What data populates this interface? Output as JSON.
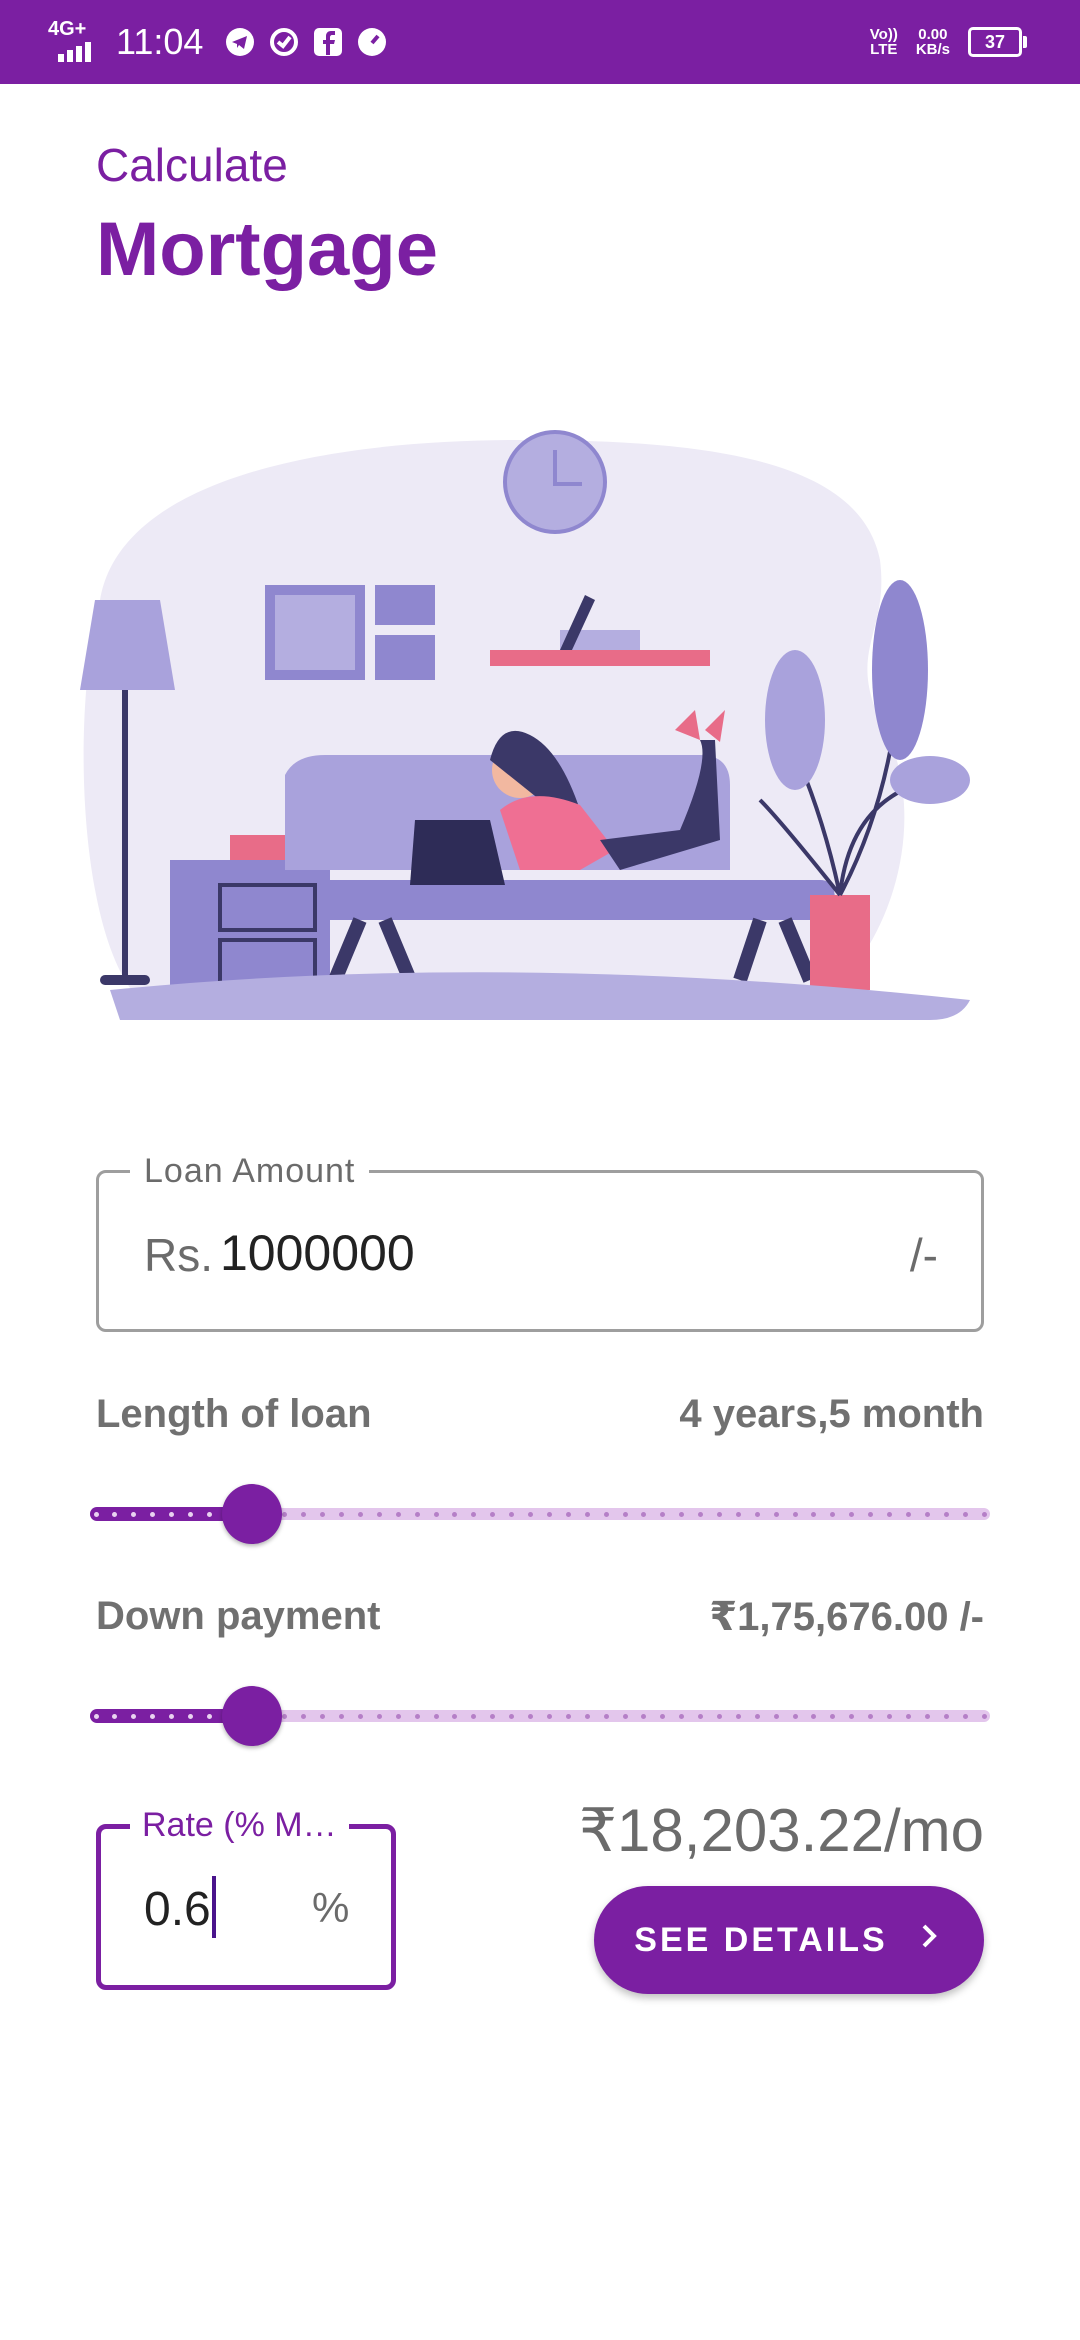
{
  "status_bar": {
    "network": "4G+",
    "time": "11:04",
    "app_icons": [
      "telegram-icon",
      "sync-icon",
      "facebook-icon",
      "speed-icon"
    ],
    "volte_line1": "Vo))",
    "volte_line2": "LTE",
    "speed_line1": "0.00",
    "speed_line2": "KB/s",
    "battery": "37"
  },
  "header": {
    "subtitle": "Calculate",
    "title": "Mortgage"
  },
  "loan_amount": {
    "label": "Loan Amount",
    "prefix": "Rs.",
    "value": "1000000",
    "suffix": "/-"
  },
  "length_of_loan": {
    "label": "Length of loan",
    "value": "4 years,5 month",
    "slider_fraction": 0.18
  },
  "down_payment": {
    "label": "Down payment",
    "value": "₹1,75,676.00 /-",
    "slider_fraction": 0.18
  },
  "rate": {
    "label": "Rate (% M…",
    "value": "0.6",
    "suffix": "%"
  },
  "result": {
    "monthly_payment": "₹18,203.22/mo",
    "button_label": "SEE DETAILS"
  },
  "colors": {
    "primary": "#7b1fa2",
    "slider_inactive": "#e3c6ec",
    "text_gray": "#707070"
  }
}
